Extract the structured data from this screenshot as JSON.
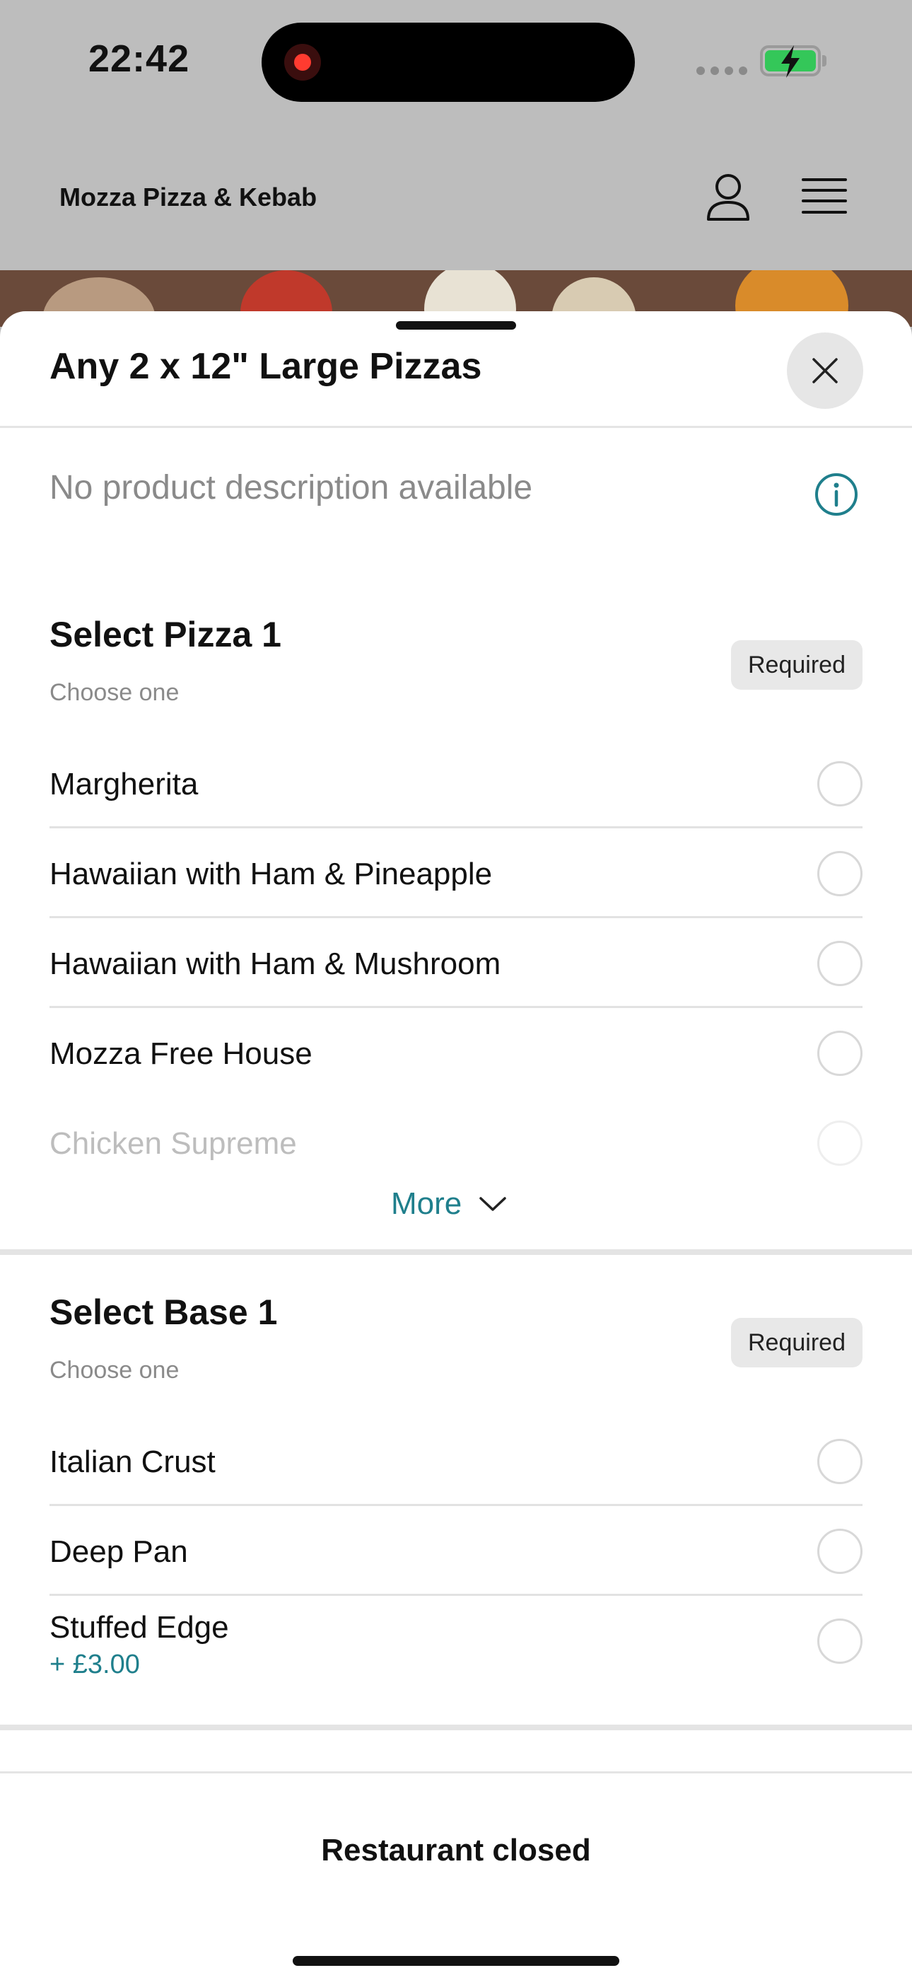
{
  "status_bar": {
    "time": "22:42",
    "battery": "charging"
  },
  "header": {
    "restaurant_name": "Mozza Pizza & Kebab",
    "profile_icon": "person-icon",
    "menu_icon": "hamburger-menu-icon"
  },
  "sheet": {
    "title": "Any 2 x 12\" Large Pizzas",
    "close_icon": "close-icon",
    "description": "No product description available",
    "info_icon": "info-icon"
  },
  "groups": [
    {
      "title": "Select Pizza 1",
      "subtitle": "Choose one",
      "badge": "Required",
      "options": [
        {
          "label": "Margherita",
          "selected": false
        },
        {
          "label": "Hawaiian with Ham & Pineapple",
          "selected": false
        },
        {
          "label": "Hawaiian with Ham & Mushroom",
          "selected": false
        },
        {
          "label": "Mozza Free House",
          "selected": false
        },
        {
          "label": "Chicken Supreme",
          "selected": false
        }
      ],
      "more_label": "More"
    },
    {
      "title": "Select Base 1",
      "subtitle": "Choose one",
      "badge": "Required",
      "options": [
        {
          "label": "Italian Crust",
          "selected": false
        },
        {
          "label": "Deep Pan",
          "selected": false
        },
        {
          "label": "Stuffed Edge",
          "price": "+ £3.00",
          "selected": false
        }
      ]
    }
  ],
  "footer": {
    "status": "Restaurant closed"
  },
  "colors": {
    "accent": "#1f7f8c",
    "badge_bg": "#e8e8e8",
    "overlay": "#bdbdbd"
  }
}
